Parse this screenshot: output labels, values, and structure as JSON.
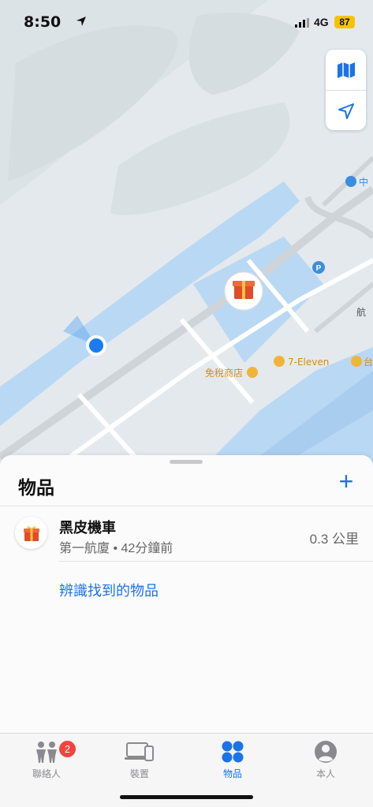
{
  "status_bar": {
    "time": "8:50",
    "network": "4G",
    "battery": "87"
  },
  "map": {
    "labels": {
      "duty_free": "免稅商店",
      "seven_eleven": "7-Eleven",
      "parking": "P",
      "edge_top": "中",
      "edge_mid": "航",
      "edge_bottom": "台"
    },
    "controls": [
      "map-mode-icon",
      "location-arrow-icon"
    ]
  },
  "sheet": {
    "title": "物品",
    "add_label": "+",
    "items": [
      {
        "name": "黑皮機車",
        "subtitle": "第一航廈 • 42分鐘前",
        "distance": "0.3 公里",
        "icon": "gift-icon"
      }
    ],
    "identify_link": "辨識找到的物品"
  },
  "tabbar": {
    "tabs": [
      {
        "label": "聯絡人",
        "icon": "people-icon",
        "badge": "2",
        "active": false
      },
      {
        "label": "裝置",
        "icon": "devices-icon",
        "active": false
      },
      {
        "label": "物品",
        "icon": "items-icon",
        "active": true
      },
      {
        "label": "本人",
        "icon": "person-icon",
        "active": false
      }
    ]
  },
  "colors": {
    "accent": "#1a73e8",
    "badge": "#f1453d",
    "map_water": "#b8d8f5",
    "map_land": "#e3e8ec"
  }
}
